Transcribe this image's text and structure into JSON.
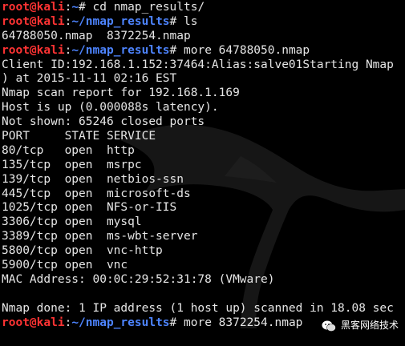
{
  "terminal": {
    "lines": [
      {
        "kind": "prompt",
        "user": "root@kali",
        "sep": ":",
        "path": "~",
        "sym": "# ",
        "cmd": "cd nmap_results/"
      },
      {
        "kind": "prompt",
        "user": "root@kali",
        "sep": ":",
        "path": "~/nmap_results",
        "sym": "# ",
        "cmd": "ls"
      },
      {
        "kind": "text",
        "text": "64788050.nmap  8372254.nmap"
      },
      {
        "kind": "prompt",
        "user": "root@kali",
        "sep": ":",
        "path": "~/nmap_results",
        "sym": "# ",
        "cmd": "more 64788050.nmap"
      },
      {
        "kind": "text",
        "text": "Client ID:192.168.1.152:37464:Alias:salve01Starting Nmap"
      },
      {
        "kind": "text",
        "text": ") at 2015-11-11 02:16 EST"
      },
      {
        "kind": "text",
        "text": "Nmap scan report for 192.168.1.169"
      },
      {
        "kind": "text",
        "text": "Host is up (0.000088s latency)."
      },
      {
        "kind": "text",
        "text": "Not shown: 65246 closed ports"
      },
      {
        "kind": "text",
        "text": "PORT     STATE SERVICE"
      },
      {
        "kind": "text",
        "text": "80/tcp   open  http"
      },
      {
        "kind": "text",
        "text": "135/tcp  open  msrpc"
      },
      {
        "kind": "text",
        "text": "139/tcp  open  netbios-ssn"
      },
      {
        "kind": "text",
        "text": "445/tcp  open  microsoft-ds"
      },
      {
        "kind": "text",
        "text": "1025/tcp open  NFS-or-IIS"
      },
      {
        "kind": "text",
        "text": "3306/tcp open  mysql"
      },
      {
        "kind": "text",
        "text": "3389/tcp open  ms-wbt-server"
      },
      {
        "kind": "text",
        "text": "5800/tcp open  vnc-http"
      },
      {
        "kind": "text",
        "text": "5900/tcp open  vnc"
      },
      {
        "kind": "text",
        "text": "MAC Address: 00:0C:29:52:31:78 (VMware)"
      },
      {
        "kind": "text",
        "text": ""
      },
      {
        "kind": "text",
        "text": "Nmap done: 1 IP address (1 host up) scanned in 18.08 sec"
      },
      {
        "kind": "prompt",
        "user": "root@kali",
        "sep": ":",
        "path": "~/nmap_results",
        "sym": "# ",
        "cmd": "more 8372254.nmap"
      }
    ]
  },
  "watermark": {
    "text": "黑客网络技术",
    "icon": "wechat-icon"
  },
  "colors": {
    "background": "#000000",
    "text": "#e6e6e6",
    "user": "#ff3333",
    "path": "#4d84ff",
    "logo": "#1a1a1a"
  }
}
